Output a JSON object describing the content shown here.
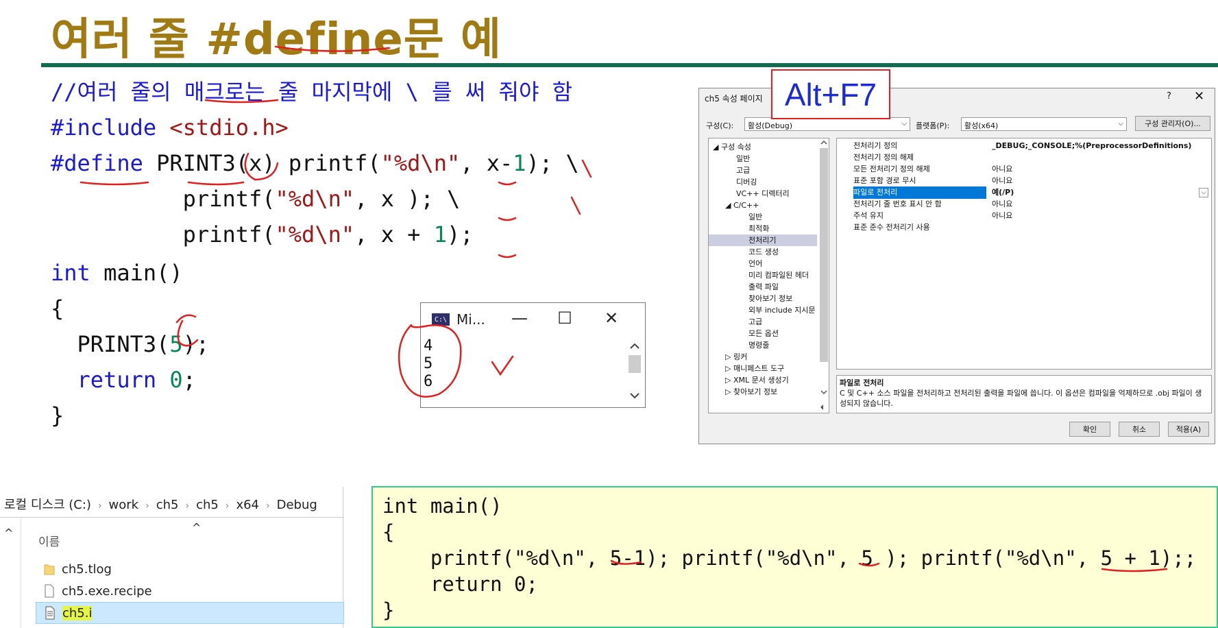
{
  "slide": {
    "title_prefix": "여러 줄 ",
    "title_keyword": "#define",
    "title_suffix": "문 예"
  },
  "code": {
    "line1_comment": "//여러 줄의 매크로는 줄 마지막에 \\ 를 써 줘야 함",
    "line2_kw": "#include",
    "line2_hdr": "<stdio.h>",
    "line3_kw": "#define",
    "line3_macro": " PRINT3(x) printf(",
    "line3_fmt": "\"%d\\n\"",
    "line3_arg": ", x-",
    "line3_num": "1",
    "line3_end": "); \\",
    "line4_pre": "          printf(",
    "line4_fmt": "\"%d\\n\"",
    "line4_end": ", x ); \\",
    "line5_pre": "          printf(",
    "line5_fmt": "\"%d\\n\"",
    "line5_arg": ", x + ",
    "line5_num": "1",
    "line5_end": ");",
    "line6_kw": "int",
    "line6_rest": " main()",
    "line7": "{",
    "line8_pre": "  PRINT3(",
    "line8_num": "5",
    "line8_end": ");",
    "line9_kw": "  return",
    "line9_num": " 0",
    "line9_end": ";",
    "line10": "}"
  },
  "console": {
    "icon_text": "C:\\",
    "title": "Mi...",
    "minimize": "—",
    "maximize": "☐",
    "close": "✕",
    "output": "4\n5\n6"
  },
  "shortcut_label": "Alt+F7",
  "dialog": {
    "title": "ch5 속성 페이지",
    "help": "?",
    "close": "✕",
    "config_label": "구성(C):",
    "config_value": "활성(Debug)",
    "platform_label": "플랫폼(P):",
    "platform_value": "활성(x64)",
    "config_manager": "구성 관리자(O)...",
    "tree": [
      "◢  구성 속성",
      "일반",
      "고급",
      "디버깅",
      "VC++ 디렉터리",
      "◢  C/C++",
      "일반",
      "최적화",
      "전처리기",
      "코드 생성",
      "언어",
      "미리 컴파일된 헤더",
      "출력 파일",
      "찾아보기 정보",
      "외부 include 지시문",
      "고급",
      "모든 옵션",
      "명령줄",
      "▷  링커",
      "▷  매니페스트 도구",
      "▷  XML 문서 생성기",
      "▷  찾아보기 정보"
    ],
    "grid": [
      {
        "key": "전처리기 정의",
        "value": "_DEBUG;_CONSOLE;%(PreprocessorDefinitions)"
      },
      {
        "key": "전처리기 정의 해제",
        "value": ""
      },
      {
        "key": "모든 전처리기 정의 해제",
        "value": "아니요"
      },
      {
        "key": "표준 포함 경로 무시",
        "value": "아니요"
      },
      {
        "key": "파일로 전처리",
        "value": "예(/P)"
      },
      {
        "key": "전처리기 줄 번호 표시 안 함",
        "value": "아니요"
      },
      {
        "key": "주석 유지",
        "value": "아니요"
      },
      {
        "key": "표준 준수 전처리기 사용",
        "value": ""
      }
    ],
    "desc_title": "파일로 전처리",
    "desc_text": "C 및 C++ 소스 파일을 전처리하고 전처리된 출력을 파일에 씁니다. 이 옵션은 컴파일을 억제하므로 .obj 파일이 생성되지 않습니다.",
    "ok": "확인",
    "cancel": "취소",
    "apply": "적용(A)"
  },
  "explorer": {
    "crumbs": [
      "로컬 디스크 (C:)",
      "work",
      "ch5",
      "ch5",
      "x64",
      "Debug"
    ],
    "column_header": "이름",
    "files": [
      {
        "name": "ch5.tlog",
        "icon": "folder-icon"
      },
      {
        "name": "ch5.exe.recipe",
        "icon": "file-icon"
      },
      {
        "name": "ch5.i",
        "icon": "text-file-icon"
      }
    ]
  },
  "expanded": {
    "l1": "int main()",
    "l2": "{",
    "l3": "    printf(\"%d\\n\", 5-1); printf(\"%d\\n\", 5 ); printf(\"%d\\n\", 5 + 1);;",
    "l4": "    return 0;",
    "l5": "}"
  },
  "colors": {
    "title": "#a07a12",
    "rule": "#146a4f",
    "keyword": "#1a1ad6",
    "string": "#a31515",
    "number": "#098658",
    "annotation": "#e02020"
  }
}
